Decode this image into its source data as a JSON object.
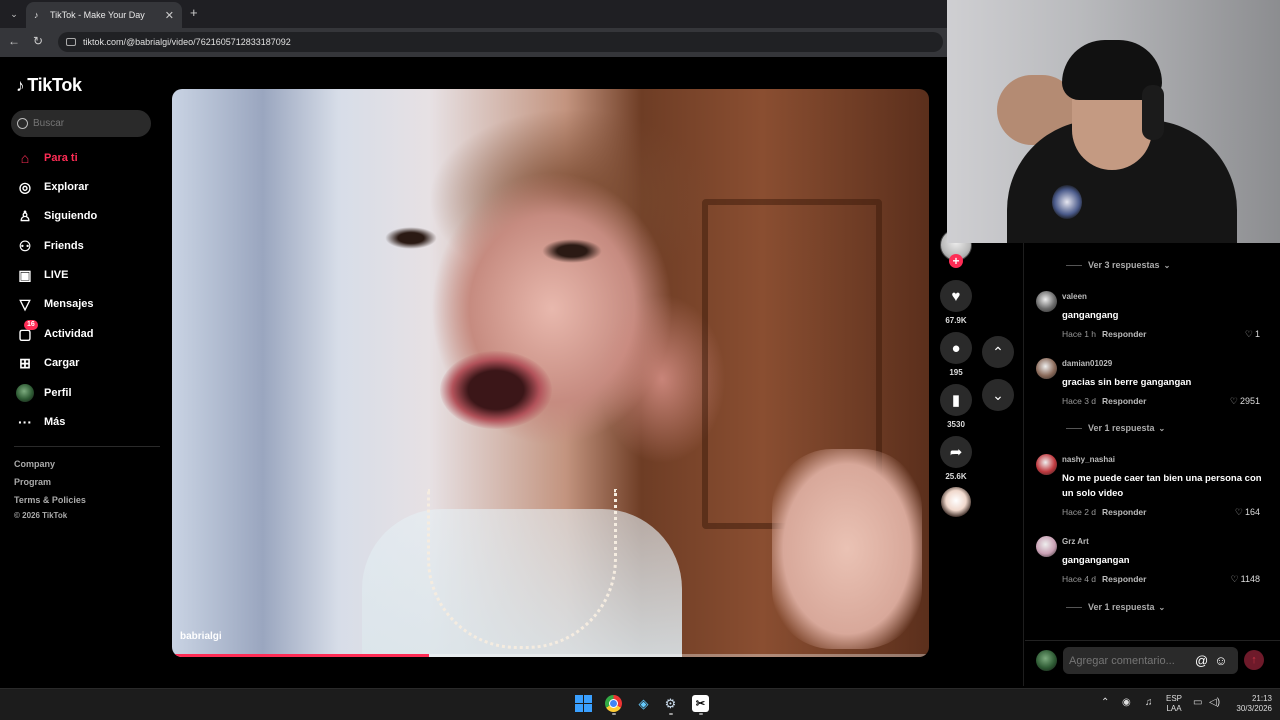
{
  "browser": {
    "tab_title": "TikTok - Make Your Day",
    "url": "tiktok.com/@babrialgi/video/7621605712833187092"
  },
  "sidebar": {
    "logo": "TikTok",
    "search_placeholder": "Buscar",
    "nav": [
      {
        "label": "Para ti",
        "icon": "home-icon",
        "active": true
      },
      {
        "label": "Explorar",
        "icon": "compass-icon"
      },
      {
        "label": "Siguiendo",
        "icon": "following-icon"
      },
      {
        "label": "Friends",
        "icon": "friends-icon"
      },
      {
        "label": "LIVE",
        "icon": "live-icon"
      },
      {
        "label": "Mensajes",
        "icon": "messages-icon"
      },
      {
        "label": "Actividad",
        "icon": "activity-icon",
        "badge": "16"
      },
      {
        "label": "Cargar",
        "icon": "upload-icon"
      },
      {
        "label": "Perfil",
        "icon": "profile-avatar"
      },
      {
        "label": "Más",
        "icon": "more-icon"
      }
    ],
    "footer": [
      "Company",
      "Program",
      "Terms & Policies",
      "© 2026 TikTok"
    ]
  },
  "video": {
    "username": "babrialgi",
    "progress": 0.34
  },
  "actions": {
    "likes": "67.9K",
    "comments": "195",
    "saves": "3530",
    "shares": "25.6K"
  },
  "comments": {
    "list": [
      {
        "type": "replies",
        "label": "Ver 3 respuestas"
      },
      {
        "user": "valeen",
        "text": "gangangang",
        "time": "Hace 1 h",
        "reply": "Responder",
        "likes": "1",
        "avatar_color": "#6b6b6b"
      },
      {
        "user": "damian01029",
        "text": "gracias sin berre gangangan",
        "time": "Hace 3 d",
        "reply": "Responder",
        "likes": "2951",
        "avatar_color": "#8a6a5a"
      },
      {
        "type": "replies",
        "label": "Ver 1 respuesta"
      },
      {
        "user": "nashy_nashai",
        "text": "No me puede caer tan bien una persona con un solo video",
        "time": "Hace 2 d",
        "reply": "Responder",
        "likes": "164",
        "avatar_color": "#c0393f"
      },
      {
        "user": "Grz Art",
        "text": "gangangangan",
        "time": "Hace 4 d",
        "reply": "Responder",
        "likes": "1148",
        "avatar_color": "#c9a0b4"
      },
      {
        "type": "replies",
        "label": "Ver 1 respuesta"
      }
    ],
    "input_placeholder": "Agregar comentario..."
  },
  "taskbar": {
    "lang_line1": "ESP",
    "lang_line2": "LAA",
    "time": "21:13",
    "date": "30/3/2026"
  },
  "colors": {
    "accent": "#fe2c55",
    "background": "#000000"
  }
}
